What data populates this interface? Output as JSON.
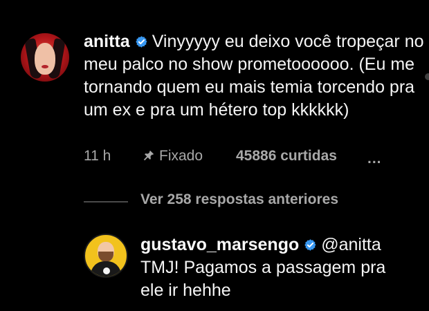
{
  "main_comment": {
    "username": "anitta",
    "text": "Vinyyyyy eu deixo você tropeçar no meu palco no show prometoooooo. (Eu me tornando quem eu mais temia torcendo pra um ex e pra um hétero top kkkkkk)",
    "time": "11 h",
    "pinned_label": "Fixado",
    "likes": "45886 curtidas",
    "more": "..."
  },
  "thread": {
    "show_replies": "Ver 258 respostas anteriores"
  },
  "reply": {
    "username": "gustavo_marsengo",
    "mention": "@anitta",
    "text": "TMJ! Pagamos a passagem pra ele ir hehhe"
  },
  "colors": {
    "background": "#000000",
    "text": "#f5f5f5",
    "secondary": "#a8a8a8",
    "verified": "#3897f0"
  }
}
